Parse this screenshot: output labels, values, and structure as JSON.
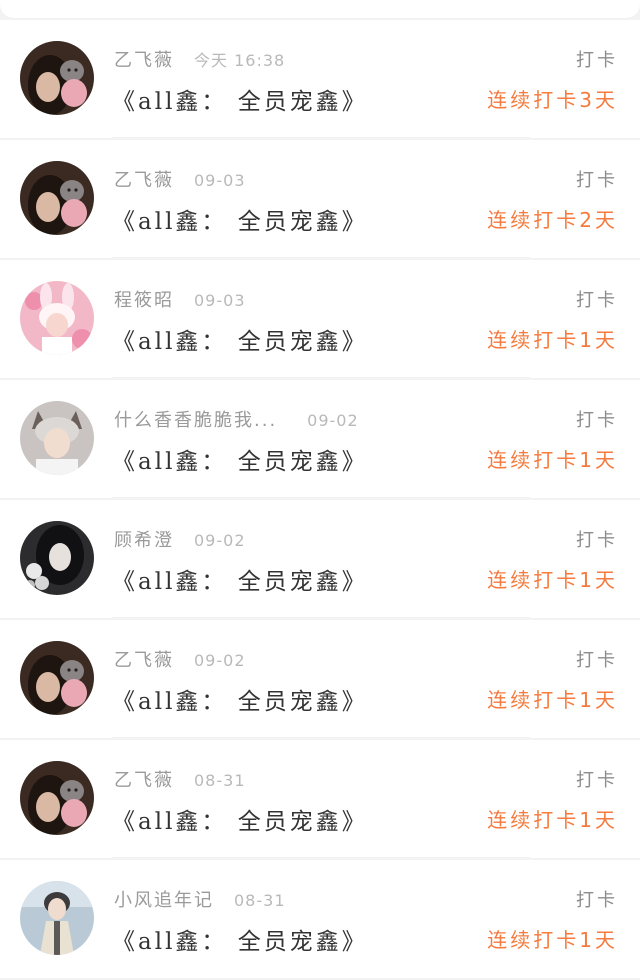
{
  "colors": {
    "streak": "#f57a3c",
    "username": "#9a9a9a",
    "title": "#333333"
  },
  "records": [
    {
      "user": "乙飞薇",
      "time": "今天 16:38",
      "book": "《all鑫： 全员宠鑫》",
      "action": "打卡",
      "streak": "连续打卡3天",
      "avatar": "avatar-brunette-with-plush"
    },
    {
      "user": "乙飞薇",
      "time": "09-03",
      "book": "《all鑫： 全员宠鑫》",
      "action": "打卡",
      "streak": "连续打卡2天",
      "avatar": "avatar-brunette-with-plush"
    },
    {
      "user": "程筱昭",
      "time": "09-03",
      "book": "《all鑫： 全员宠鑫》",
      "action": "打卡",
      "streak": "连续打卡1天",
      "avatar": "avatar-pink-bunny"
    },
    {
      "user": "什么香香脆脆我...",
      "time": "09-02",
      "book": "《all鑫： 全员宠鑫》",
      "action": "打卡",
      "streak": "连续打卡1天",
      "avatar": "avatar-cat-ears-boy"
    },
    {
      "user": "顾希澄",
      "time": "09-02",
      "book": "《all鑫： 全员宠鑫》",
      "action": "打卡",
      "streak": "连续打卡1天",
      "avatar": "avatar-dark-hair-flowers"
    },
    {
      "user": "乙飞薇",
      "time": "09-02",
      "book": "《all鑫： 全员宠鑫》",
      "action": "打卡",
      "streak": "连续打卡1天",
      "avatar": "avatar-brunette-with-plush"
    },
    {
      "user": "乙飞薇",
      "time": "08-31",
      "book": "《all鑫： 全员宠鑫》",
      "action": "打卡",
      "streak": "连续打卡1天",
      "avatar": "avatar-brunette-with-plush"
    },
    {
      "user": "小风追年记",
      "time": "08-31",
      "book": "《all鑫： 全员宠鑫》",
      "action": "打卡",
      "streak": "连续打卡1天",
      "avatar": "avatar-boy-in-coat"
    }
  ]
}
